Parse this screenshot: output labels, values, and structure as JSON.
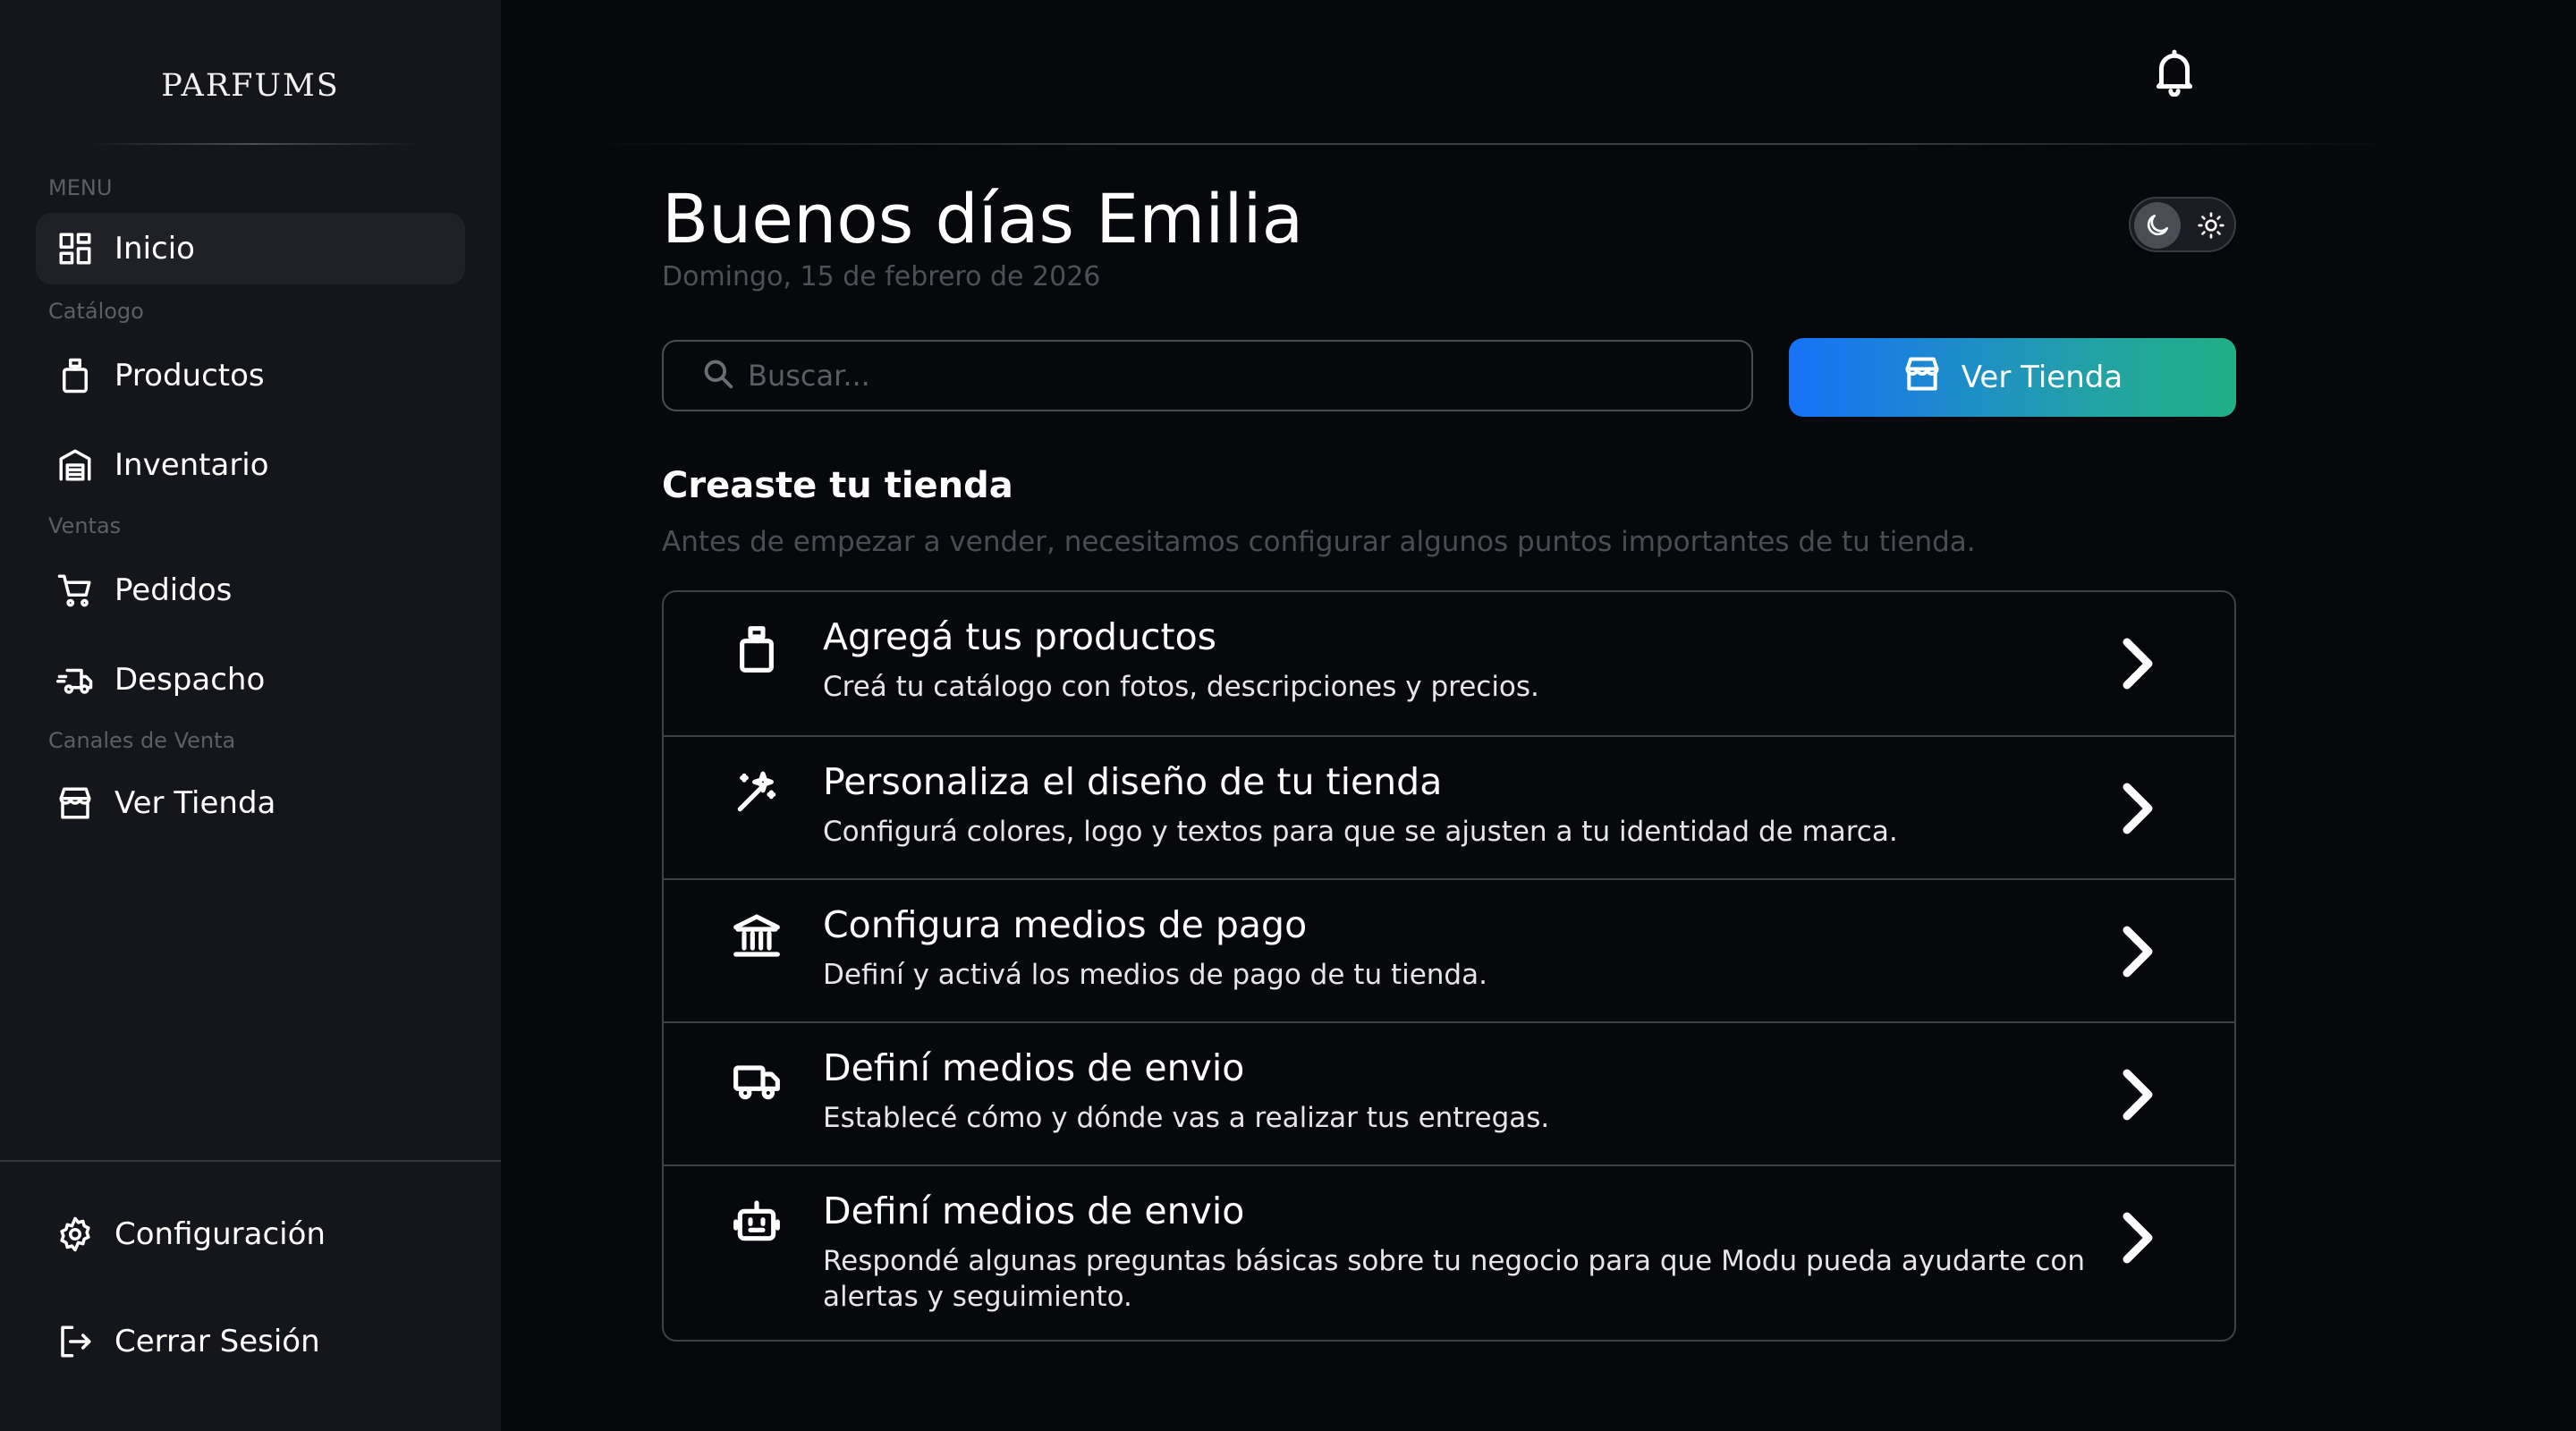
{
  "sidebar": {
    "brand": "PARFUMS",
    "sections": {
      "menu": "MENU",
      "catalog": "Catálogo",
      "sales": "Ventas",
      "channels": "Canales de Venta"
    },
    "items": [
      {
        "label": "Inicio",
        "icon": "grid-icon",
        "active": true
      },
      {
        "label": "Productos",
        "icon": "bottle-icon"
      },
      {
        "label": "Inventario",
        "icon": "warehouse-icon"
      },
      {
        "label": "Pedidos",
        "icon": "cart-icon"
      },
      {
        "label": "Despacho",
        "icon": "truck-fast-icon"
      },
      {
        "label": "Ver Tienda",
        "icon": "store-icon"
      }
    ],
    "bottom": [
      {
        "label": "Configuración",
        "icon": "gear-icon"
      },
      {
        "label": "Cerrar Sesión",
        "icon": "logout-icon"
      }
    ]
  },
  "header": {
    "notification_icon": "bell-icon"
  },
  "main": {
    "greeting": "Buenos días Emilia",
    "date": "Domingo, 15 de febrero de 2026",
    "theme": "dark",
    "search": {
      "placeholder": "Buscar...",
      "value": ""
    },
    "store_button": "Ver Tienda",
    "setup": {
      "title": "Creaste tu tienda",
      "subtitle": "Antes de empezar a vender, necesitamos configurar algunos puntos importantes de tu tienda.",
      "tasks": [
        {
          "title": "Agregá tus productos",
          "desc": "Creá tu catálogo con fotos, descripciones y precios.",
          "icon": "bottle-icon"
        },
        {
          "title": "Personaliza el diseño de tu tienda",
          "desc": "Configurá colores, logo y textos para que se ajusten a tu identidad de marca.",
          "icon": "magic-wand-icon"
        },
        {
          "title": "Configura medios de pago",
          "desc": "Definí y activá los medios de pago de tu tienda.",
          "icon": "bank-icon"
        },
        {
          "title": "Definí medios de envio",
          "desc": "Establecé cómo y dónde vas a realizar tus entregas.",
          "icon": "truck-icon"
        },
        {
          "title": "Definí medios de envio",
          "desc": "Respondé algunas preguntas básicas sobre tu negocio para que Modu pueda ayudarte con alertas y seguimiento.",
          "icon": "robot-icon"
        }
      ]
    }
  },
  "colors": {
    "background": "#07080b",
    "sidebar": "#15161b",
    "accent_start": "#1671f7",
    "accent_end": "#1faf86"
  }
}
